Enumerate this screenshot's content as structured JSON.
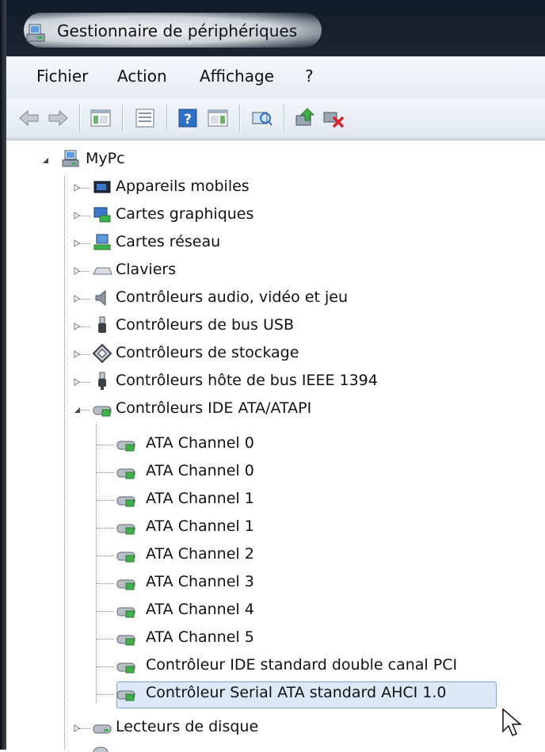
{
  "window": {
    "title": "Gestionnaire de périphériques"
  },
  "menu": [
    "Fichier",
    "Action",
    "Affichage",
    "?"
  ],
  "toolbar": {
    "buttons": [
      "back-icon",
      "forward-icon",
      "show-hide-console-tree-icon",
      "properties-icon",
      "help-icon",
      "action-pane-icon",
      "scan-hardware-icon",
      "update-driver-icon",
      "uninstall-device-icon"
    ]
  },
  "tree": {
    "root": "MyPc",
    "categories": [
      "Appareils mobiles",
      "Cartes graphiques",
      "Cartes réseau",
      "Claviers",
      "Contrôleurs audio, vidéo et jeu",
      "Contrôleurs de bus USB",
      "Contrôleurs de stockage",
      "Contrôleurs hôte de bus IEEE 1394",
      "Contrôleurs IDE ATA/ATAPI"
    ],
    "ide_children": [
      "ATA Channel 0",
      "ATA Channel 0",
      "ATA Channel 1",
      "ATA Channel 1",
      "ATA Channel 2",
      "ATA Channel 3",
      "ATA Channel 4",
      "ATA Channel 5",
      "Contrôleur IDE standard double canal PCI",
      "Contrôleur Serial ATA standard AHCI 1.0"
    ],
    "after": [
      "Lecteurs de disque"
    ]
  }
}
